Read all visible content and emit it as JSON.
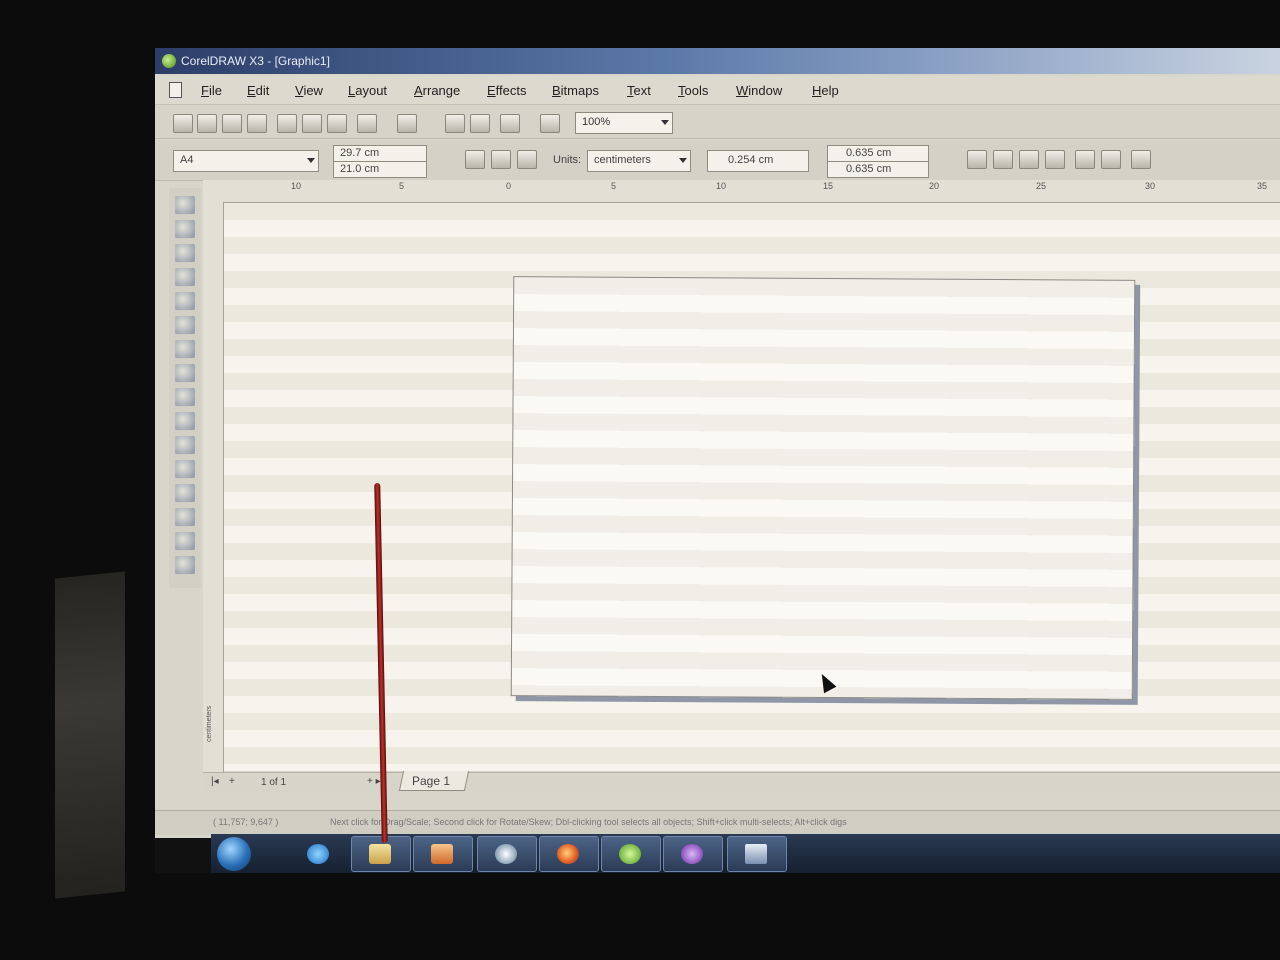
{
  "window": {
    "title": "CorelDRAW X3 - [Graphic1]"
  },
  "menu": [
    "File",
    "Edit",
    "View",
    "Layout",
    "Arrange",
    "Effects",
    "Bitmaps",
    "Text",
    "Tools",
    "Window",
    "Help"
  ],
  "toolbar": {
    "zoom": "100%"
  },
  "property_bar": {
    "paper_size": "A4",
    "width": "29.7 cm",
    "height": "21.0 cm",
    "units_label": "Units:",
    "units_value": "centimeters",
    "nudge": "0.254 cm",
    "duplicate_x": "0.635 cm",
    "duplicate_y": "0.635 cm"
  },
  "ruler": {
    "top_ticks": [
      "10",
      "5",
      "0",
      "5",
      "10",
      "15",
      "20",
      "25",
      "30",
      "35"
    ],
    "unit_label": "centimeters"
  },
  "page_nav": {
    "counter": "1 of 1",
    "page_tab": "Page 1"
  },
  "status": {
    "coordinates": "( 11,757; 9,647 )",
    "hint": "Next click for Drag/Scale; Second click for Rotate/Skew; Dbl-clicking tool selects all objects; Shift+click multi-selects; Alt+click digs"
  },
  "colors": {
    "titlebar": "#3c5585",
    "taskbar": "#1e2c40",
    "canvas": "#efece3"
  }
}
